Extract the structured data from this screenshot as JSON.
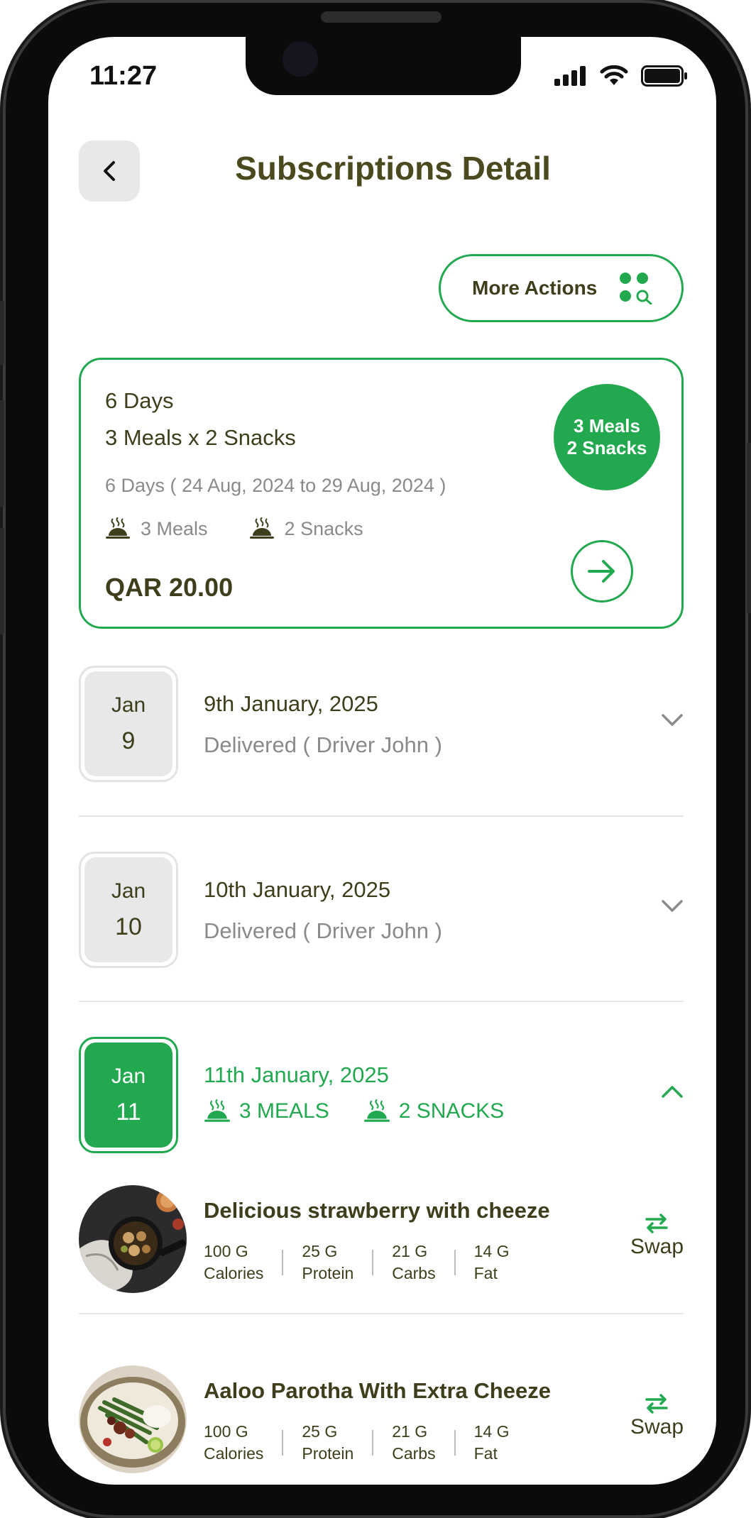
{
  "status_bar": {
    "time": "11:27"
  },
  "header": {
    "title": "Subscriptions Detail"
  },
  "more_actions": {
    "label": "More Actions"
  },
  "plan": {
    "days": "6 Days",
    "meals_snacks": "3 Meals x 2 Snacks",
    "date_range": "6 Days ( 24 Aug, 2024 to 29 Aug, 2024 )",
    "meals_count": "3 Meals",
    "snacks_count": "2 Snacks",
    "price": "QAR 20.00",
    "badge_line1": "3 Meals",
    "badge_line2": "2 Snacks"
  },
  "days": [
    {
      "month": "Jan",
      "day": "9",
      "title": "9th January, 2025",
      "status": "Delivered ( Driver John )"
    },
    {
      "month": "Jan",
      "day": "10",
      "title": "10th January, 2025",
      "status": "Delivered ( Driver John )"
    },
    {
      "month": "Jan",
      "day": "11",
      "title": "11th January, 2025",
      "meals_tag": "3 MEALS",
      "snacks_tag": "2 SNACKS"
    }
  ],
  "meals": [
    {
      "name": "Delicious strawberry with cheeze",
      "calories_value": "100 G",
      "calories_label": "Calories",
      "protein_value": "25 G",
      "protein_label": "Protein",
      "carbs_value": "21 G",
      "carbs_label": "Carbs",
      "fat_value": "14 G",
      "fat_label": "Fat",
      "swap_label": "Swap"
    },
    {
      "name": "Aaloo Parotha With Extra Cheeze",
      "calories_value": "100 G",
      "calories_label": "Calories",
      "protein_value": "25 G",
      "protein_label": "Protein",
      "carbs_value": "21 G",
      "carbs_label": "Carbs",
      "fat_value": "14 G",
      "fat_label": "Fat",
      "swap_label": "Swap"
    }
  ],
  "colors": {
    "accent": "#22a94f",
    "text_dark": "#3e3e1c",
    "text_muted": "#8a8a8a"
  }
}
